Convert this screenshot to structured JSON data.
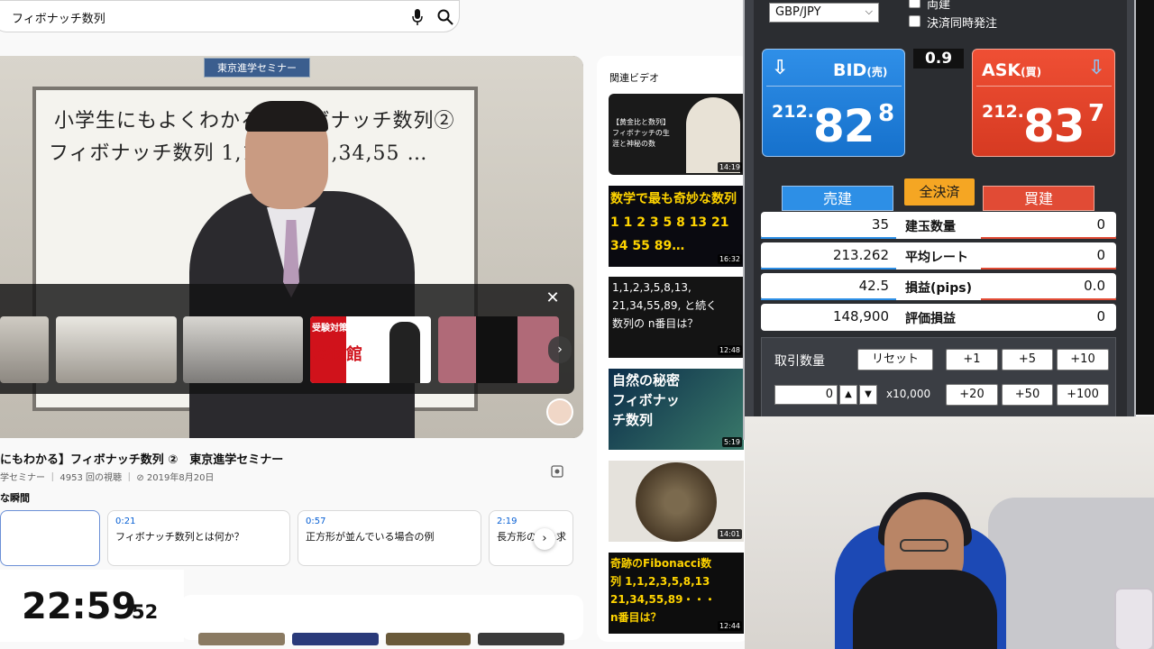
{
  "search": {
    "query": "フィボナッチ数列"
  },
  "player": {
    "board_line1": "小学生にもよくわかる フィボナッチ数列②",
    "board_line2": "フィボナッチ数列 1,1, 13,21,34,55 …",
    "signboard": "東京進学セミナー",
    "overlay_thumb_4_text": "桜修館",
    "overlay_thumb_4_tag": "受験対策"
  },
  "video": {
    "title": "にもわかる】フィボナッチ数列 ②　東京進学セミナー",
    "meta": "学セミナー ｜ 4953 回の視聴 ｜ ⊘ 2019年8月20日",
    "moments_label": "な瞬間",
    "chapters": [
      {
        "time": "",
        "desc": ""
      },
      {
        "time": "0:21",
        "desc": "フィボナッチ数列とは何か？"
      },
      {
        "time": "0:57",
        "desc": "正方形が並んでいる場合の例"
      },
      {
        "time": "2:19",
        "desc": "長方形の　を求"
      }
    ]
  },
  "clock": {
    "hm": "22:59",
    "sec": "52"
  },
  "related": {
    "header": "関連ビデオ",
    "items": [
      {
        "duration": "14:19",
        "overlay": "【黄金比と数列】フィボナッチの生涯と神秘の数"
      },
      {
        "duration": "16:32",
        "overlay": "数学で最も奇妙な数列 1 1 2 3 5 8 13 21 34 55 89…"
      },
      {
        "duration": "12:48",
        "overlay": "1,1,2,3,5,8,13, 21,34,55,89, と続く数列の n番目は？"
      },
      {
        "duration": "5:19",
        "overlay": "自然の秘密 フィボナッチ数列"
      },
      {
        "duration": "14:01",
        "overlay": ""
      },
      {
        "duration": "12:44",
        "overlay": "奇跡のFibonacci数列 1,1,2,3,5,8,13 21,34,55,89・・・ n番目は？"
      }
    ]
  },
  "trade": {
    "pair": "GBP/JPY",
    "check1": "両建",
    "check2": "決済同時発注",
    "bid": {
      "label": "BID",
      "sub": "(売)",
      "int": "212.",
      "big": "82",
      "small": "8"
    },
    "ask": {
      "label": "ASK",
      "sub": "(買)",
      "int": "212.",
      "big": "83",
      "small": "7"
    },
    "spread": "0.9",
    "tab_sell": "売建",
    "tab_close_all": "全決済",
    "tab_buy": "買建",
    "rows": [
      {
        "left": "35",
        "label": "建玉数量",
        "right": "0"
      },
      {
        "left": "213.262",
        "label": "平均レート",
        "right": "0"
      },
      {
        "left": "42.5",
        "label": "損益(pips)",
        "right": "0.0"
      },
      {
        "left": "148,900",
        "label": "評価損益",
        "right": "0"
      }
    ],
    "qty_label": "取引数量",
    "reset": "リセット",
    "plus1": "+1",
    "plus5": "+5",
    "plus10": "+10",
    "plus20": "+20",
    "plus50": "+50",
    "plus100": "+100",
    "qty_value": "0",
    "unit": "x10,000"
  },
  "colors": {
    "bid": "#1671cc",
    "ask": "#d63a22",
    "close_all": "#f5a623"
  }
}
